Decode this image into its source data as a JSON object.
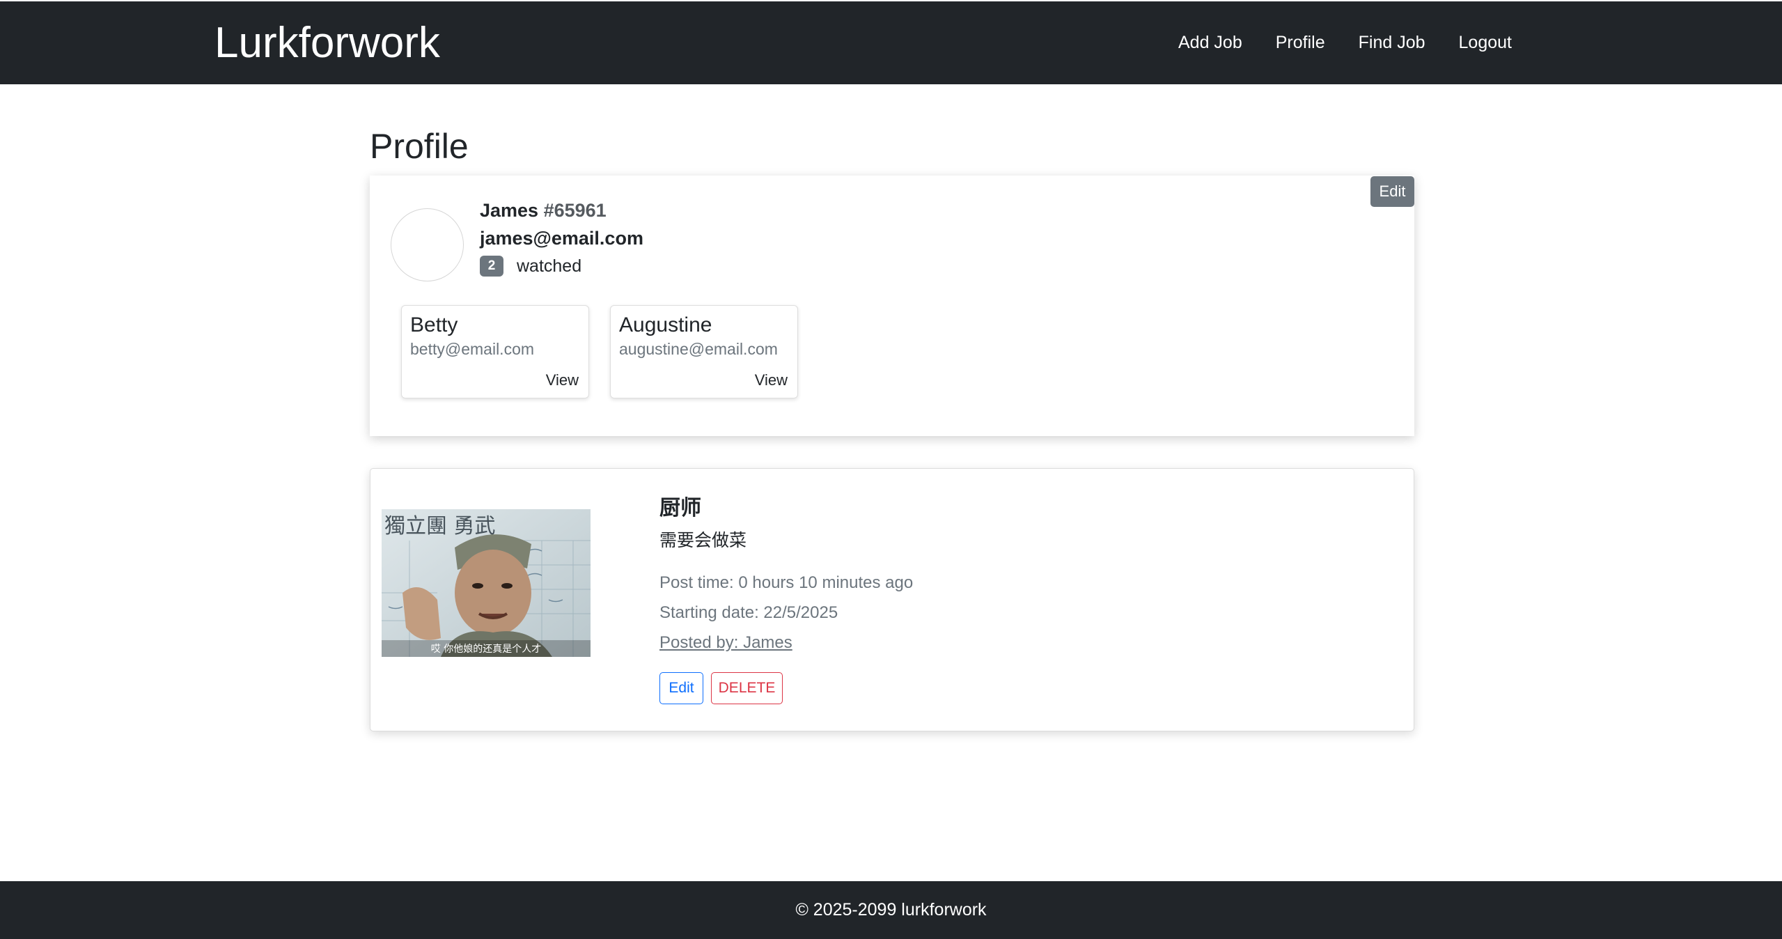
{
  "navbar": {
    "brand": "Lurkforwork",
    "links": [
      "Add Job",
      "Profile",
      "Find Job",
      "Logout"
    ]
  },
  "page": {
    "title": "Profile"
  },
  "profile": {
    "edit_label": "Edit",
    "name": "James",
    "id": "#65961",
    "email": "james@email.com",
    "watched_count": "2",
    "watched_label": "watched",
    "watched_users": [
      {
        "name": "Betty",
        "email": "betty@email.com",
        "view_label": "View"
      },
      {
        "name": "Augustine",
        "email": "augustine@email.com",
        "view_label": "View"
      }
    ]
  },
  "job": {
    "title": "厨师",
    "description": "需要会做菜",
    "post_time": "Post time: 0 hours 10 minutes ago",
    "starting_date": "Starting date: 22/5/2025",
    "posted_by": "Posted by: James",
    "image_caption": "哎  你他娘的还真是个人才",
    "image_banner": "獨立團   勇武",
    "edit_label": "Edit",
    "delete_label": "DELETE"
  },
  "footer": {
    "text": "© 2025-2099 lurkforwork"
  },
  "colors": {
    "navbar_bg": "#212529",
    "secondary": "#6c757d",
    "primary": "#0d6efd",
    "danger": "#dc3545"
  }
}
